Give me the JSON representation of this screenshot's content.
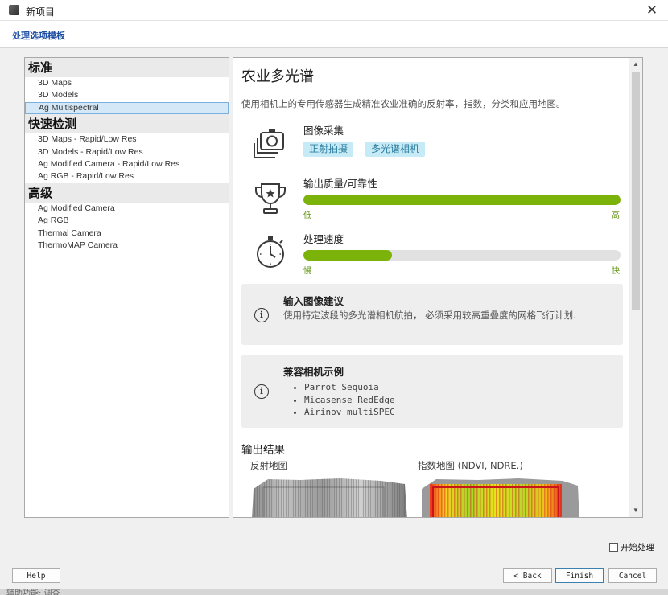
{
  "window": {
    "title": "新项目",
    "close_glyph": "✕"
  },
  "header": {
    "template_label": "处理选项模板"
  },
  "sidebar": {
    "sections": [
      {
        "title": "标准",
        "items": [
          "3D Maps",
          "3D Models",
          "Ag Multispectral"
        ]
      },
      {
        "title": "快速检测",
        "items": [
          "3D Maps - Rapid/Low Res",
          "3D Models - Rapid/Low Res",
          "Ag Modified Camera - Rapid/Low Res",
          "Ag RGB - Rapid/Low Res"
        ]
      },
      {
        "title": "高级",
        "items": [
          "Ag Modified Camera",
          "Ag RGB",
          "Thermal Camera",
          "ThermoMAP Camera"
        ]
      }
    ],
    "selected_item": "Ag Multispectral"
  },
  "detail": {
    "title": "农业多光谱",
    "description": "使用相机上的专用传感器生成精准农业准确的反射率，指数，分类和应用地图。",
    "capture": {
      "label": "图像采集",
      "tags": [
        "正射拍摄",
        "多光谱相机"
      ],
      "icon": "photos-icon"
    },
    "quality": {
      "label": "输出质量/可靠性",
      "value": 1.0,
      "low": "低",
      "high": "高",
      "icon": "trophy-icon"
    },
    "speed": {
      "label": "处理速度",
      "value": 0.28,
      "low": "慢",
      "high": "快",
      "icon": "stopwatch-icon"
    },
    "input_advice": {
      "title": "输入图像建议",
      "text": "使用特定波段的多光谱相机航拍， 必须采用较高重叠度的网格飞行计划."
    },
    "cameras": {
      "title": "兼容相机示例",
      "items": [
        "Parrot Sequoia",
        "Micasense RedEdge",
        "Airinov multiSPEC"
      ]
    },
    "outputs": {
      "title": "输出结果",
      "reflectance_label": "反射地图",
      "index_label": "指数地图 (NDVI, NDRE.)"
    },
    "accent_color": "#7cb30a",
    "tag_color": "#c7ebf6"
  },
  "footer": {
    "start_processing": "开始处理",
    "help": "Help",
    "back": "< Back",
    "finish": "Finish",
    "cancel": "Cancel"
  },
  "taskbar_fragment": "辅助功能: 调查"
}
